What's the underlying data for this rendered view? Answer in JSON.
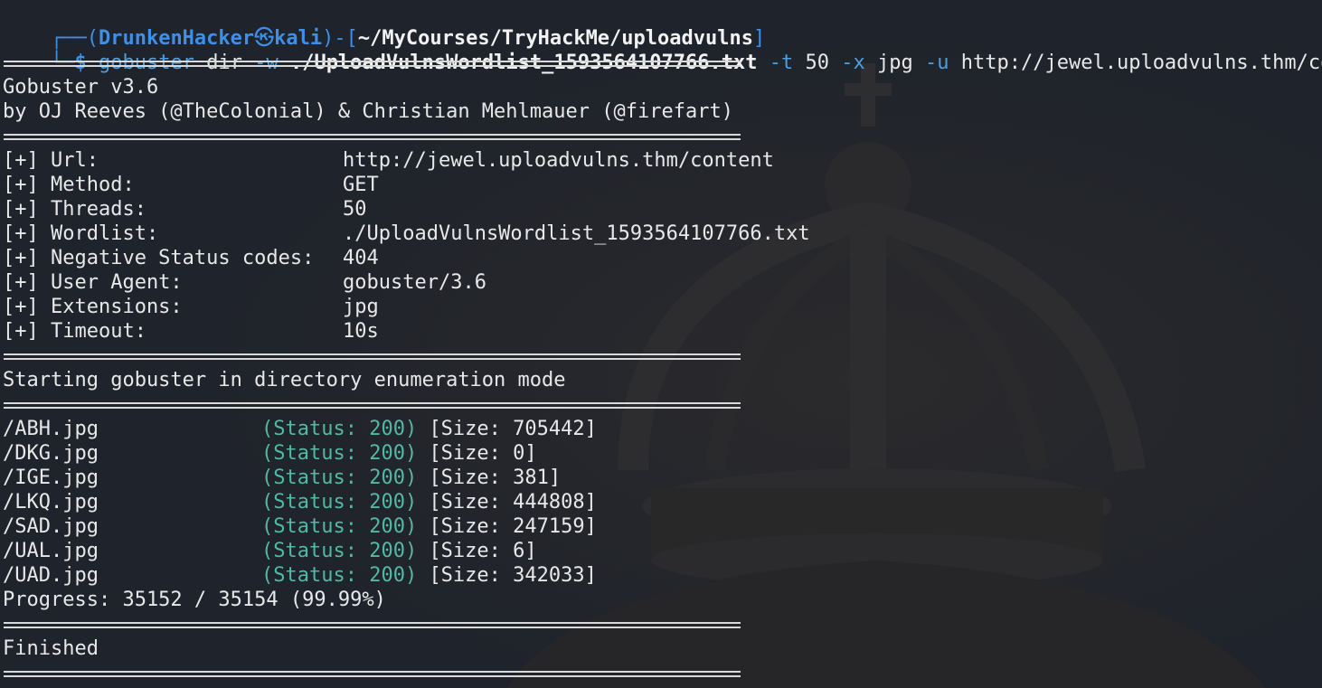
{
  "prompt": {
    "frame_top": "┌──(",
    "user": "DrunkenHacker",
    "skull": "㉿",
    "host": "kali",
    "mid": ")-[",
    "cwd": "~/MyCourses/TryHackMe/uploadvulns",
    "end": "]",
    "frame_bottom": "└─",
    "dollar": "$"
  },
  "command": {
    "bin": "gobuster",
    "sub": "dir",
    "w_flag": "-w",
    "wordlist": "./UploadVulnsWordlist_1593564107766.txt",
    "t_flag": "-t",
    "threads": "50",
    "x_flag": "-x",
    "ext": "jpg",
    "u_flag": "-u",
    "url": "http://jewel.uploadvulns.thm/content"
  },
  "banner": {
    "version": "Gobuster v3.6",
    "authors": "by OJ Reeves (@TheColonial) & Christian Mehlmauer (@firefart)"
  },
  "config": [
    {
      "label": "[+] Url:",
      "value": "http://jewel.uploadvulns.thm/content"
    },
    {
      "label": "[+] Method:",
      "value": "GET"
    },
    {
      "label": "[+] Threads:",
      "value": "50"
    },
    {
      "label": "[+] Wordlist:",
      "value": "./UploadVulnsWordlist_1593564107766.txt"
    },
    {
      "label": "[+] Negative Status codes:",
      "value": "404"
    },
    {
      "label": "[+] User Agent:",
      "value": "gobuster/3.6"
    },
    {
      "label": "[+] Extensions:",
      "value": "jpg"
    },
    {
      "label": "[+] Timeout:",
      "value": "10s"
    }
  ],
  "start_msg": "Starting gobuster in directory enumeration mode",
  "results": [
    {
      "path": "/ABH.jpg",
      "status": "(Status: 200)",
      "size": "[Size: 705442]"
    },
    {
      "path": "/DKG.jpg",
      "status": "(Status: 200)",
      "size": "[Size: 0]"
    },
    {
      "path": "/IGE.jpg",
      "status": "(Status: 200)",
      "size": "[Size: 381]"
    },
    {
      "path": "/LKQ.jpg",
      "status": "(Status: 200)",
      "size": "[Size: 444808]"
    },
    {
      "path": "/SAD.jpg",
      "status": "(Status: 200)",
      "size": "[Size: 247159]"
    },
    {
      "path": "/UAL.jpg",
      "status": "(Status: 200)",
      "size": "[Size: 6]"
    },
    {
      "path": "/UAD.jpg",
      "status": "(Status: 200)",
      "size": "[Size: 342033]"
    }
  ],
  "progress": "Progress: 35152 / 35154 (99.99%)",
  "finished": "Finished",
  "colors": {
    "background": "#1f232b",
    "prompt_blue": "#3d8fe8",
    "status_teal": "#52b9a6",
    "text": "#e8e8e8"
  },
  "background_icon": "crown-watermark"
}
